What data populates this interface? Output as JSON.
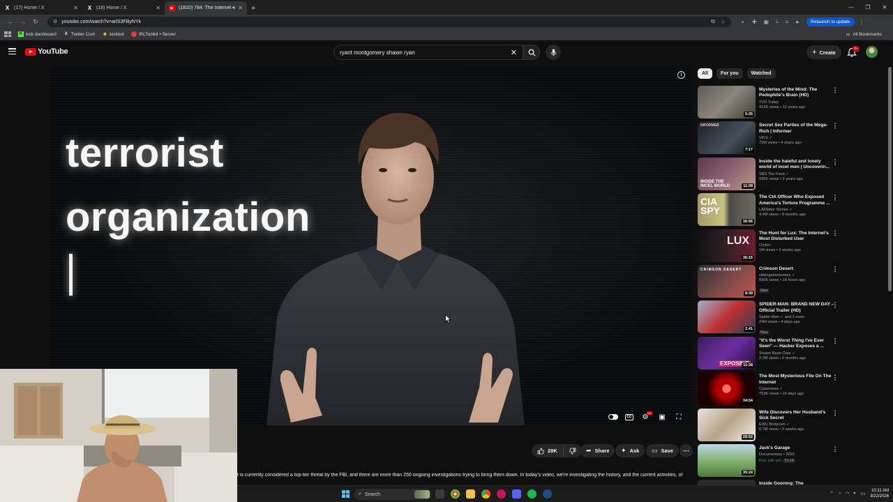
{
  "browser": {
    "tabs": [
      {
        "label": "(17) Home / X",
        "favicon": "x-logo-icon",
        "active": false
      },
      {
        "label": "(18) Home / X",
        "favicon": "x-logo-icon",
        "active": false
      },
      {
        "label": "(1810) 784: The Internet's M",
        "favicon": "youtube-icon",
        "active": true
      }
    ],
    "url": "youtube.com/watch?v=arlS3FByNYk",
    "relaunch_label": "Relaunch to update",
    "bookmarks": [
      {
        "label": "kick dashboard",
        "icon": "kick-icon",
        "color": "#53fc18"
      },
      {
        "label": "Twitter Com",
        "icon": "x-logo-icon",
        "color": "#ffffff"
      },
      {
        "label": "kickbot",
        "icon": "kickbot-icon",
        "color": "#f5c518"
      },
      {
        "label": "IRLToolkit • Server",
        "icon": "irltoolkit-icon",
        "color": "#e53935"
      }
    ],
    "all_bookmarks_label": "All Bookmarks"
  },
  "youtube": {
    "logo_text": "YouTube",
    "search_value": "ryant montgomery shawn ryan",
    "create_label": "Create",
    "notification_count": "9+",
    "video_overlay": {
      "line1": "terrorist",
      "line2": "organization"
    },
    "actions": {
      "like_count": "28K",
      "share_label": "Share",
      "ask_label": "Ask",
      "save_label": "Save"
    },
    "description": "t is currently considered a top-tier threat by the FBI, and there are more than 250 ongoing investigations trying to bring them down. In today's video, we're investigating the history, and the current activities, of",
    "chips": [
      {
        "label": "All",
        "active": true
      },
      {
        "label": "For you",
        "active": false
      },
      {
        "label": "Watched",
        "active": false
      }
    ],
    "recommendations": [
      {
        "title": "Mysteries of the Mind: The Pedophile's Brain (HD)",
        "channel": "TVO Today",
        "stats": "413K views • 12 years ago",
        "duration": "5:25",
        "verified": false
      },
      {
        "title": "Secret Sex Parties of the Mega-Rich | Informer",
        "channel": "VICE",
        "stats": "72M views • 4 years ago",
        "duration": "7:17",
        "verified": true,
        "thumb_text": "INFORMER"
      },
      {
        "title": "Inside the hateful and lonely world of incel men | Uncoverin...",
        "channel": "SBS The Feed",
        "stats": "935K views • 2 years ago",
        "duration": "11:08",
        "verified": true,
        "thumb_text": "INSIDE THE INCEL WORLD"
      },
      {
        "title": "The CIA Officer Who Exposed America's Torture Programme ...",
        "channel": "LADbible Stories",
        "stats": "4.4M views • 8 months ago",
        "duration": "36:56",
        "verified": true,
        "thumb_text": "CIA SPY"
      },
      {
        "title": "The Hunt for Lux: The Internet's Most Disturbed User",
        "channel": "Cryton",
        "stats": "1M views • 2 weeks ago",
        "duration": "36:15",
        "verified": false,
        "thumb_text": "LUX"
      },
      {
        "title": "Crimson Desert",
        "channel": "videogamedunkey",
        "stats": "830K views • 18 hours ago",
        "duration": "8:39",
        "verified": true,
        "badge": "New",
        "thumb_text": "CRIMSON DESERT"
      },
      {
        "title": "SPIDER-MAN: BRAND NEW DAY – Official Trailer (HD)",
        "channel": "Spider-Man",
        "channel_extra": "and 3 more",
        "stats": "24M views • 4 days ago",
        "duration": "2:41",
        "verified": true,
        "badge": "New"
      },
      {
        "title": "\"It's the Worst Thing I've Ever Seen\" — Hacker Exposes a ...",
        "channel": "Shawn Ryan Clips",
        "stats": "2.2M views • 3 months ago",
        "duration": "11:38",
        "verified": true,
        "thumb_text": "EXPOSING"
      },
      {
        "title": "The Most Mysterious File On The Internet",
        "channel": "Cybernews",
        "stats": "753K views • 10 days ago",
        "duration": "34:54",
        "verified": true
      },
      {
        "title": "Wife Discovers Her Husband's Sick Secret",
        "channel": "EWU Bodycam",
        "stats": "6.7M views • 3 weeks ago",
        "duration": "28:52",
        "verified": true
      },
      {
        "title": "Jack's Garage",
        "channel": "Documentary • 2022",
        "stats": "",
        "free": "Free with ads",
        "rating": "TV-14",
        "duration": "35:24",
        "verified": false
      },
      {
        "title": "Inside Gooning: The",
        "channel": "",
        "stats": "",
        "duration": "",
        "verified": false
      }
    ]
  },
  "taskbar": {
    "search_placeholder": "Search",
    "time": "10:11 AM",
    "date": "3/22/2026"
  },
  "colors": {
    "accent_red": "#ff0000",
    "chip_active_bg": "#f1f1f1",
    "relaunch_blue": "#0b57d0"
  }
}
